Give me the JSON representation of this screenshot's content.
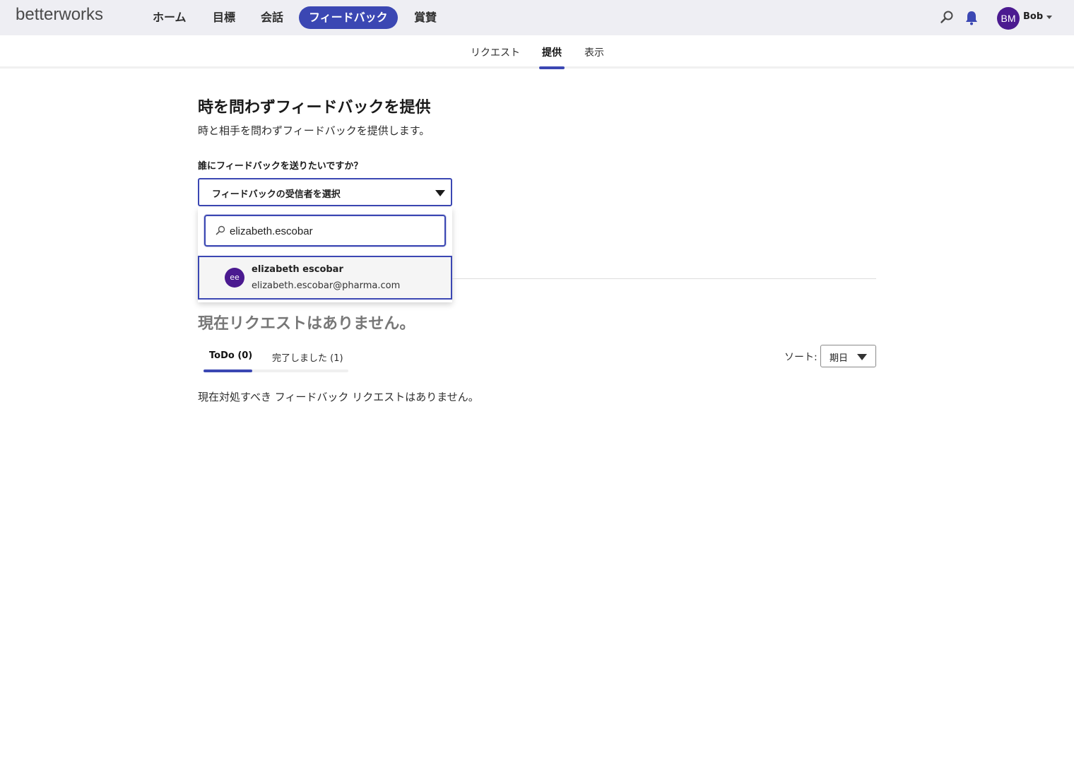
{
  "app": {
    "logo": "betterworks"
  },
  "nav": {
    "items": [
      {
        "label": "ホーム"
      },
      {
        "label": "目標"
      },
      {
        "label": "会話"
      },
      {
        "label": "フィードバック",
        "active": true
      },
      {
        "label": "賞賛"
      }
    ]
  },
  "user": {
    "initials": "BM",
    "name": "Bob"
  },
  "subtabs": [
    {
      "label": "リクエスト"
    },
    {
      "label": "提供",
      "active": true
    },
    {
      "label": "表示"
    }
  ],
  "main": {
    "title": "時を問わずフィードバックを提供",
    "subtitle": "時と相手を問わずフィードバックを提供します。",
    "recipient_label": "誰にフィードバックを送りたいですか？",
    "recipient_select_placeholder": "フィードバックの受信者を選択",
    "search": {
      "value": "elizabeth.escobar"
    },
    "results": [
      {
        "initials": "ee",
        "name": "elizabeth escobar",
        "email": "elizabeth.escobar@pharma.com"
      }
    ]
  },
  "requests": {
    "title": "現在リクエストはありません。",
    "tabs": [
      {
        "label": "ToDo (0)",
        "active": true
      },
      {
        "label": "完了しました (1)"
      }
    ],
    "sort_label": "ソート:",
    "sort_value": "期日",
    "empty_message": "現在対処すべき フィードバック リクエストはありません。"
  },
  "colors": {
    "accent": "#3b47b3",
    "avatar": "#4b1a90",
    "topbar": "#eeeef3"
  },
  "icons": [
    "search-icon",
    "bell-icon",
    "caret-down-icon"
  ]
}
